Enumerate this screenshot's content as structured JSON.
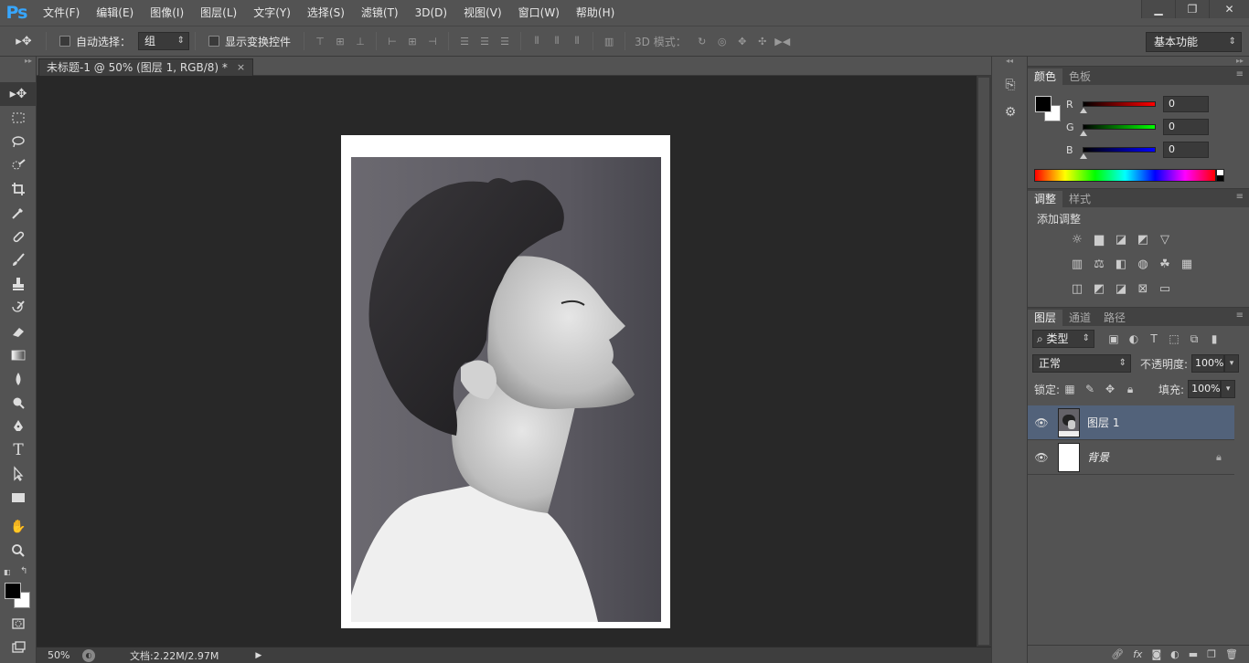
{
  "app": {
    "logo": "Ps"
  },
  "menu": [
    "文件(F)",
    "编辑(E)",
    "图像(I)",
    "图层(L)",
    "文字(Y)",
    "选择(S)",
    "滤镜(T)",
    "3D(D)",
    "视图(V)",
    "窗口(W)",
    "帮助(H)"
  ],
  "window": {
    "minimize": "▁",
    "restore": "❐",
    "close": "✕"
  },
  "options": {
    "auto_select_label": "自动选择：",
    "auto_select_value": "组",
    "show_transform_label": "显示变换控件",
    "mode_3d_label": "3D 模式：",
    "workspace": "基本功能"
  },
  "document": {
    "tab_title": "未标题-1 @ 50% (图层 1, RGB/8) *",
    "tab_close": "×",
    "zoom": "50%",
    "doc_size": "文档:2.22M/2.97M"
  },
  "color_panel": {
    "tabs": [
      "颜色",
      "色板"
    ],
    "r_label": "R",
    "r_value": "0",
    "g_label": "G",
    "g_value": "0",
    "b_label": "B",
    "b_value": "0"
  },
  "adjust_panel": {
    "tabs": [
      "调整",
      "样式"
    ],
    "title": "添加调整"
  },
  "layers_panel": {
    "tabs": [
      "图层",
      "通道",
      "路径"
    ],
    "filter_kind": "类型",
    "blend_mode": "正常",
    "opacity_label": "不透明度:",
    "opacity_value": "100%",
    "lock_label": "锁定:",
    "fill_label": "填充:",
    "fill_value": "100%",
    "layers": [
      {
        "name": "图层 1"
      },
      {
        "name": "背景"
      }
    ]
  },
  "colors": {
    "accent": "#37a6ff",
    "selected_layer": "#52627a",
    "ui_bg": "#535353",
    "canvas_bg": "#282828"
  }
}
